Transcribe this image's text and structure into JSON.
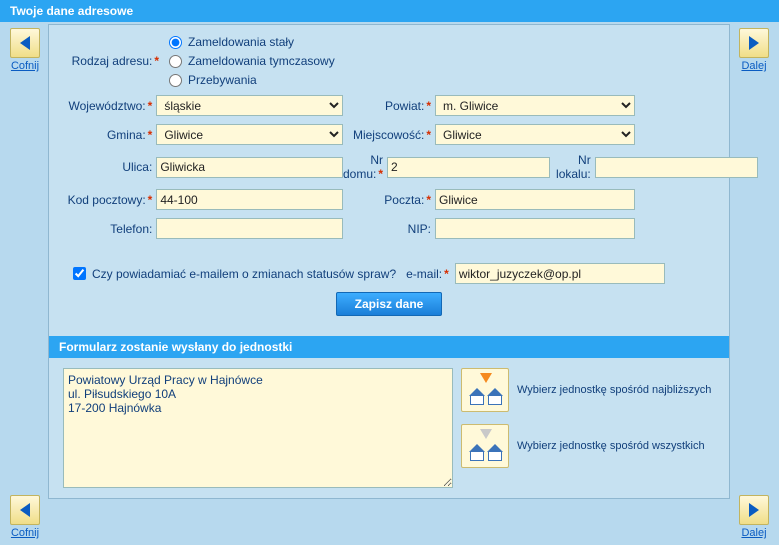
{
  "header": {
    "title": "Twoje dane adresowe"
  },
  "nav": {
    "back": "Cofnij",
    "next": "Dalej"
  },
  "form": {
    "rodzaj_adresu_label": "Rodzaj adresu:",
    "radio": {
      "staly": "Zameldowania stały",
      "tymczasowy": "Zameldowania tymczasowy",
      "przebywania": "Przebywania"
    },
    "wojewodztwo_label": "Województwo:",
    "wojewodztwo": "śląskie",
    "powiat_label": "Powiat:",
    "powiat": "m. Gliwice",
    "gmina_label": "Gmina:",
    "gmina": "Gliwice",
    "miejscowosc_label": "Miejscowość:",
    "miejscowosc": "Gliwice",
    "ulica_label": "Ulica:",
    "ulica": "Gliwicka",
    "nrdomu_label": "Nr domu:",
    "nrdomu": "2",
    "nrlokalu_label": "Nr lokalu:",
    "nrlokalu": "",
    "kod_label": "Kod pocztowy:",
    "kod": "44-100",
    "poczta_label": "Poczta:",
    "poczta": "Gliwice",
    "telefon_label": "Telefon:",
    "telefon": "",
    "nip_label": "NIP:",
    "nip": "",
    "notify_label": "Czy powiadamiać e-mailem o zmianach statusów spraw?",
    "email_label": "e-mail:",
    "email": "wiktor_juzyczek@op.pl",
    "save_label": "Zapisz dane"
  },
  "unit_section": {
    "title": "Formularz zostanie wysłany do jednostki",
    "address": "Powiatowy Urząd Pracy w Hajnówce\nul. Piłsudskiego 10A\n17-200 Hajnówka",
    "pick_nearest": "Wybierz jednostkę spośród najbliższych",
    "pick_all": "Wybierz jednostkę spośród wszystkich"
  }
}
